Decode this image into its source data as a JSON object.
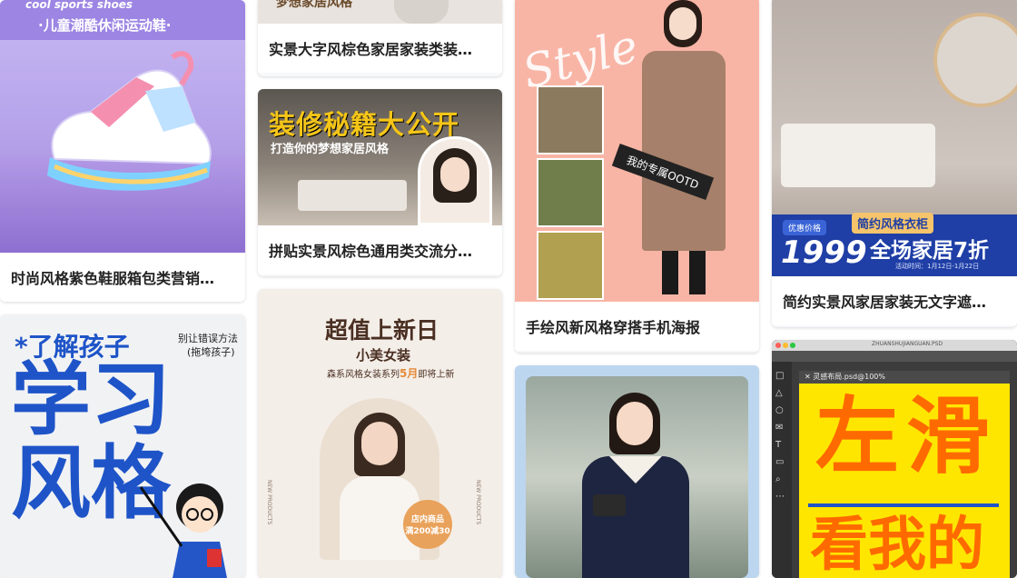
{
  "cards": {
    "sneaker": {
      "caption": "时尚风格紫色鞋服箱包类营销…",
      "header_en": "cool sports shoes",
      "header_zh": "·儿童潮酷休闲运动鞋·",
      "accent": "#8b76d9"
    },
    "home_text": {
      "caption": "实景大字风棕色家居家装类装…",
      "thumb_text": "梦想家居风格"
    },
    "decor_secrets": {
      "caption": "拼贴实景风棕色通用类交流分…",
      "title": "装修秘籍大公开",
      "subtitle": "打造你的梦想家居风格",
      "accent": "#f5c518"
    },
    "learning": {
      "title_small": "*了解孩子",
      "side_note_1": "别让错误方法",
      "side_note_2": "(拖垮孩子)",
      "big_1": "学习",
      "big_2": "风格",
      "accent": "#1e54c8"
    },
    "new_arrivals": {
      "title": "超值上新日",
      "subtitle": "小美女装",
      "line": "森系风格女装系列",
      "month": "5月",
      "line_end": "即将上新",
      "side_left": "NEW PRODUCTS",
      "side_right": "NEW PRODUCTS",
      "badge_1": "店内商品",
      "badge_2": "满200减30"
    },
    "ootd": {
      "caption": "手绘风新风格穿搭手机海报",
      "script_word": "Style",
      "arrow_text": "我的专属OOTD",
      "bg": "#f8b5a6"
    },
    "portrait": {
      "bg": "#bcd6f0"
    },
    "bedroom": {
      "caption": "简约实景风家居家装无文字遮…",
      "price_tag": "优惠价格",
      "price": "1999",
      "product": "简约风格衣柜",
      "slogan": "全场家居7折",
      "event": "活动时间：1月12日-1月22日",
      "accent": "#1f3fa6"
    },
    "editor": {
      "window_title": "ZHUANSHUJIANGUAN.PSD",
      "tab": "灵感布局.psd@100%",
      "big_1": "左",
      "big_2": "滑",
      "big_3": "看我的",
      "accent": "#ff6a00",
      "bg": "#ffe600"
    }
  }
}
